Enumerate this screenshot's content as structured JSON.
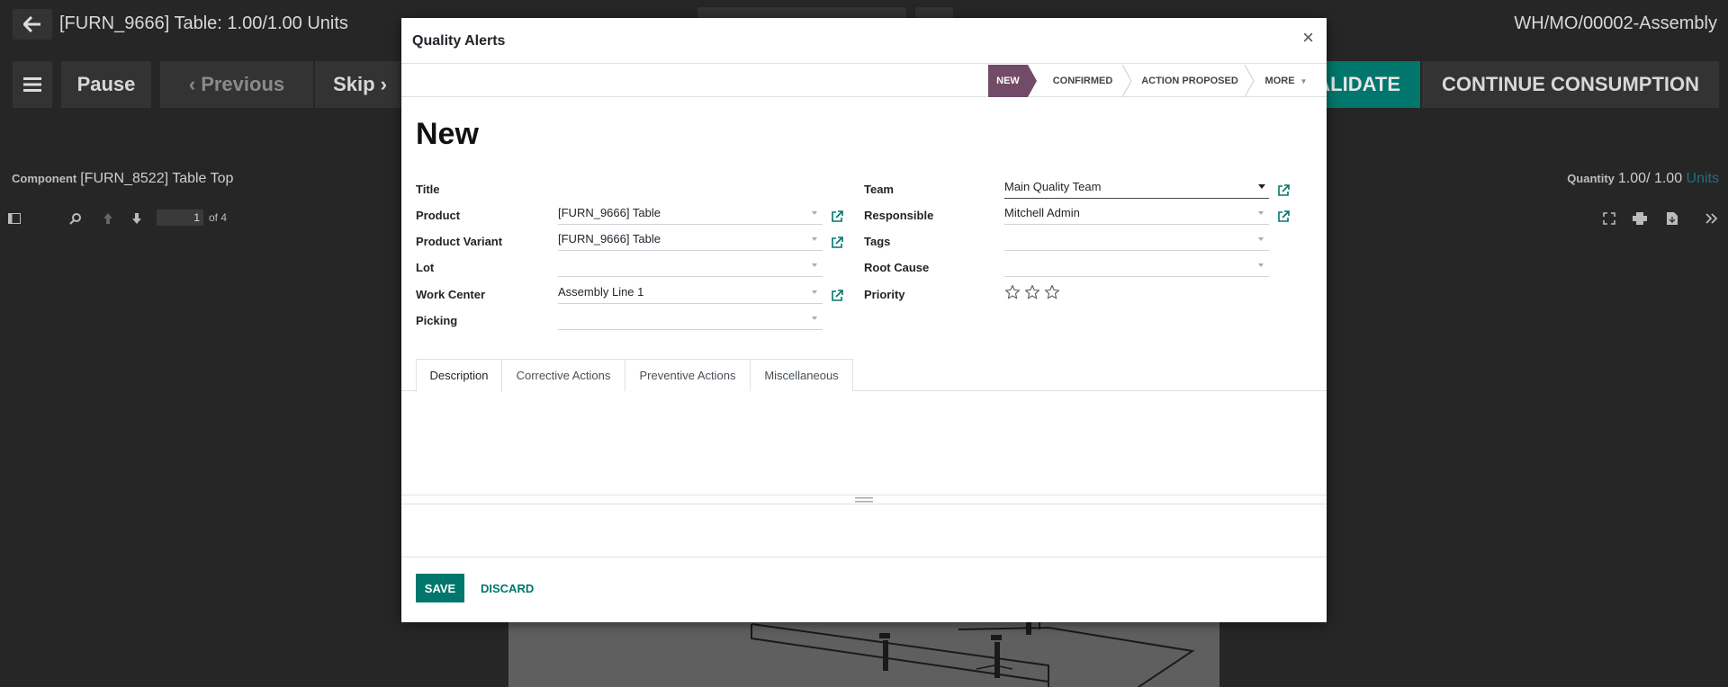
{
  "topbar": {
    "title": "[FURN_9666] Table: 1.00/1.00 Units",
    "right_text": "WH/MO/00002-Assembly"
  },
  "toolbar": {
    "pause": "Pause",
    "previous": "Previous",
    "skip": "Skip",
    "validate": "ALIDATE",
    "continue": "CONTINUE CONSUMPTION"
  },
  "component": {
    "label": "Component",
    "value": "[FURN_8522] Table Top"
  },
  "quantity": {
    "label": "Quantity",
    "value": "1.00/ 1.00",
    "units": "Units"
  },
  "pdf": {
    "page": "1",
    "of": "of 4"
  },
  "modal": {
    "title": "Quality Alerts",
    "close": "×",
    "stages": [
      "NEW",
      "CONFIRMED",
      "ACTION PROPOSED",
      "MORE"
    ],
    "record_name": "New",
    "left_fields": [
      {
        "label": "Title",
        "value": ""
      },
      {
        "label": "Product",
        "value": "[FURN_9666] Table"
      },
      {
        "label": "Product Variant",
        "value": "[FURN_9666] Table"
      },
      {
        "label": "Lot",
        "value": ""
      },
      {
        "label": "Work Center",
        "value": "Assembly Line 1"
      },
      {
        "label": "Picking",
        "value": ""
      }
    ],
    "right_fields": [
      {
        "label": "Team",
        "value": "Main Quality Team"
      },
      {
        "label": "Responsible",
        "value": "Mitchell Admin"
      },
      {
        "label": "Tags",
        "value": ""
      },
      {
        "label": "Root Cause",
        "value": ""
      },
      {
        "label": "Priority",
        "value": ""
      }
    ],
    "priority": {
      "stars": 3,
      "filled": 0
    },
    "tabs": [
      "Description",
      "Corrective Actions",
      "Preventive Actions",
      "Miscellaneous"
    ],
    "save": "SAVE",
    "discard": "DISCARD"
  },
  "colors": {
    "primary": "#00766c",
    "stage_active": "#714b67"
  }
}
